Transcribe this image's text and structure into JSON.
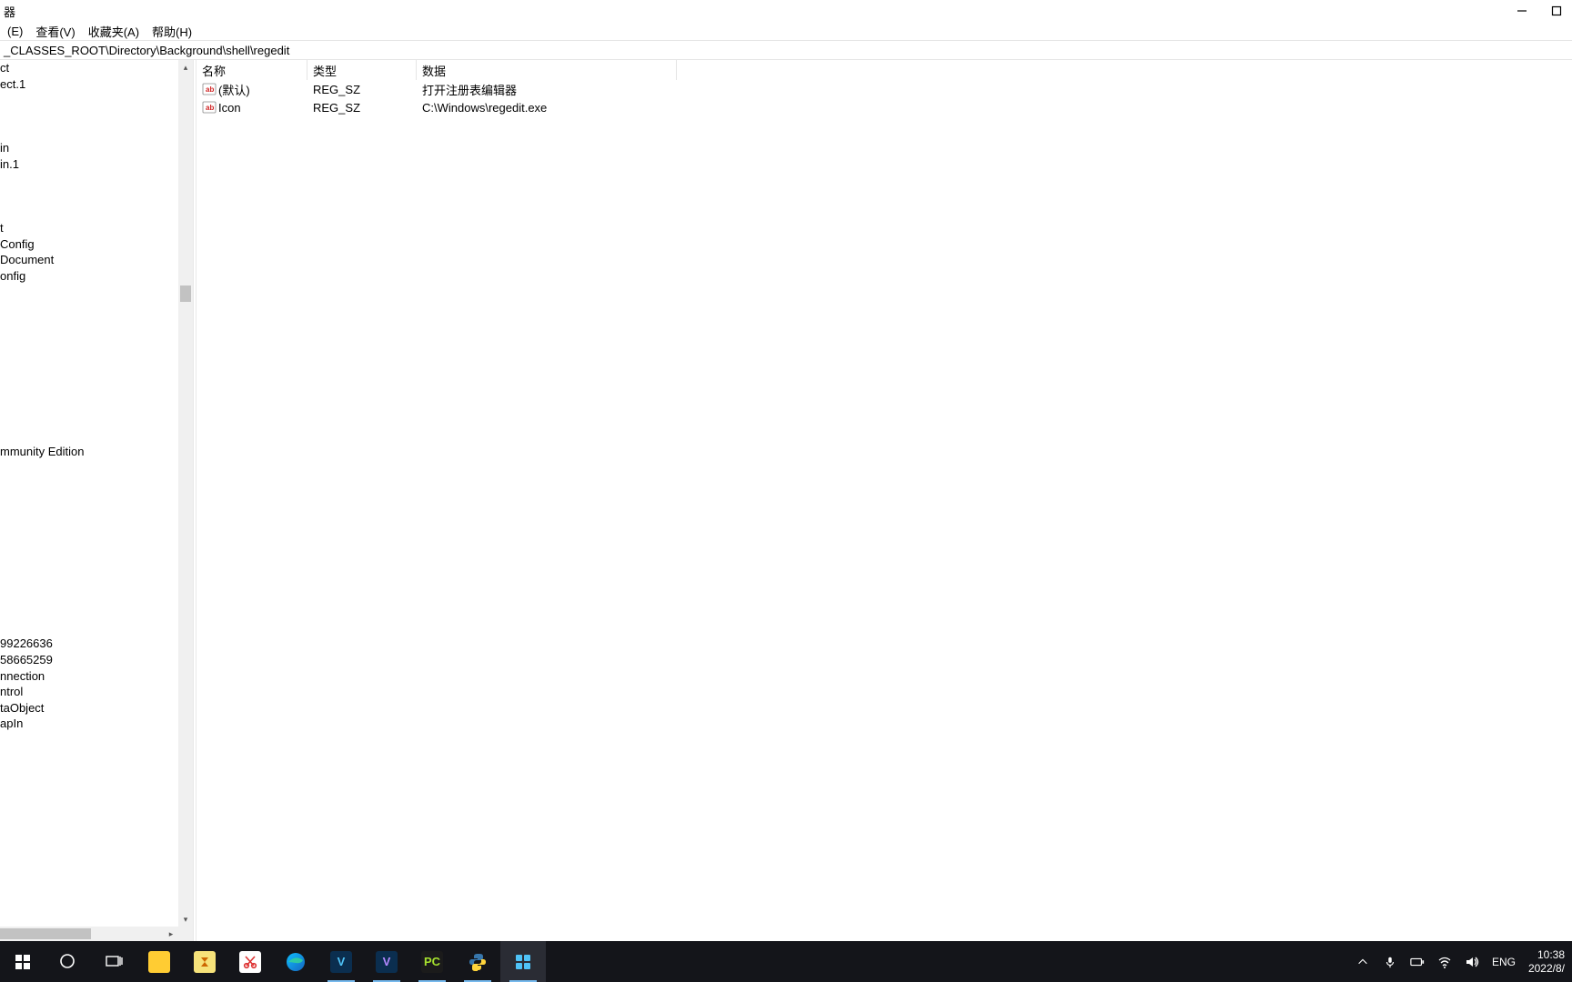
{
  "window": {
    "title_suffix": "器"
  },
  "menu": {
    "edit": "(E)",
    "view": "查看(V)",
    "favorites": "收藏夹(A)",
    "help": "帮助(H)"
  },
  "address": "_CLASSES_ROOT\\Directory\\Background\\shell\\regedit",
  "tree_items": [
    "ct",
    "ect.1",
    "",
    "",
    "",
    "in",
    "in.1",
    "",
    "",
    "",
    "t",
    "Config",
    "Document",
    "onfig",
    "",
    "",
    "",
    "",
    "",
    "",
    "",
    "",
    "",
    "",
    "mmunity Edition",
    "",
    "",
    "",
    "",
    "",
    "",
    "",
    "",
    "",
    "",
    "",
    "99226636",
    "58665259",
    "nnection",
    "ntrol",
    "taObject",
    "apIn"
  ],
  "columns": {
    "name": "名称",
    "type": "类型",
    "data": "数据"
  },
  "rows": [
    {
      "name": "(默认)",
      "type": "REG_SZ",
      "data": "打开注册表编辑器"
    },
    {
      "name": "Icon",
      "type": "REG_SZ",
      "data": "C:\\Windows\\regedit.exe"
    }
  ],
  "tray": {
    "lang": "ENG",
    "time": "10:38",
    "date": "2022/8/"
  }
}
